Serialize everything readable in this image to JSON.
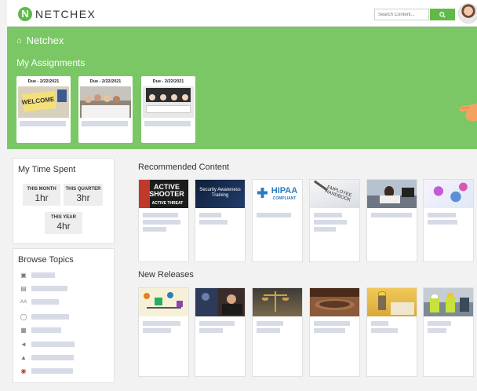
{
  "brand": {
    "logo_text": "NETCHEX",
    "home_label": "Netchex"
  },
  "colors": {
    "accent": "#5fba47",
    "hero": "#7bc766",
    "placeholder": "#d6dbe6"
  },
  "search": {
    "placeholder": "Search Content...",
    "button_icon": "search-icon"
  },
  "assignments": {
    "title": "My Assignments",
    "cards": [
      {
        "due": "Due - 2/22/2021",
        "thumb_text": "WELCOME"
      },
      {
        "due": "Due - 2/22/2021"
      },
      {
        "due": "Due - 2/22/2021"
      }
    ]
  },
  "time_spent": {
    "title": "My Time Spent",
    "stats": [
      {
        "label": "THIS MONTH",
        "value": "1hr"
      },
      {
        "label": "THIS QUARTER",
        "value": "3hr"
      },
      {
        "label": "THIS YEAR",
        "value": "4hr"
      }
    ]
  },
  "browse": {
    "title": "Browse Topics",
    "topic_icons": [
      "monitor-icon",
      "document-icon",
      "text-size-icon",
      "people-icon",
      "calendar-icon",
      "megaphone-icon",
      "graduation-cap-icon",
      "target-icon"
    ]
  },
  "recommended": {
    "title": "Recommended Content",
    "cards": [
      {
        "thumb_text": "ACTIVE SHOOTER",
        "sub_text": "ACTIVE THREAT"
      },
      {
        "thumb_text": "Security Awareness Training"
      },
      {
        "thumb_text": "HIPAA",
        "sub_text": "COMPLIANT"
      },
      {
        "thumb_text": "EMPLOYEE HANDBOOK"
      },
      {
        "thumb_text": ""
      },
      {
        "thumb_text": ""
      }
    ]
  },
  "new_releases": {
    "title": "New Releases"
  }
}
